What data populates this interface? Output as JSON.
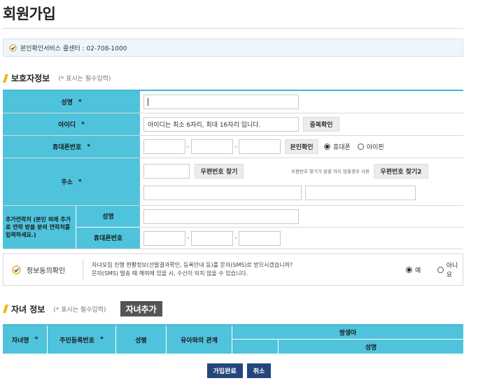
{
  "page": {
    "title": "회원가입"
  },
  "notice": {
    "text": "본인확인서비스 콜센터 : 02-708-1000",
    "icon": "check-circle-icon"
  },
  "guardian": {
    "title": "보호자정보",
    "note": "(* 표시는 필수입력)",
    "name_label": "성명",
    "id_label": "아이디",
    "id_hint": "아이디는 최소 6자리, 최대 16자리 입니다.",
    "dup_check_label": "중복확인",
    "phone_label": "휴대폰번호",
    "verify_label": "본인확인",
    "phone_type_options": [
      "휴대폰",
      "아이핀"
    ],
    "phone_type_selected": "휴대폰",
    "address_label": "주소",
    "zip_search_label": "우편번호 찾기",
    "zip_note": "우편번호 찾기가 원할 하지 않을경우 사용",
    "zip_search2_label": "우편번호 찾기2",
    "extra_contact_label": "추가연락처 (본인 외에 추가로 연락 받을 분의 연락처를 입력하세요.)",
    "extra_name_label": "성명",
    "extra_phone_label": "휴대폰번호",
    "required_mark": "*"
  },
  "consent": {
    "label": "정보동의확인",
    "line1": "자녀모집 진행 현황정보(선발결과확인, 등록안내 등)를 문자(SMS)로 받으시겠습니까?",
    "line2": "문자(SMS) 발송 때 해외에 있을 시, 수신이 되지 않을 수 있습니다.",
    "options": [
      "예",
      "아니요"
    ],
    "selected": "예"
  },
  "children": {
    "title": "자녀 정보",
    "note": "(* 표시는 필수입력)",
    "add_label": "자녀추가",
    "columns": [
      "자녀명",
      "주민등록번호",
      "성별",
      "유아와의 관계"
    ],
    "twin_label": "쌍생아",
    "twin_sub": "성명"
  },
  "actions": {
    "submit_label": "가입완료",
    "cancel_label": "취소"
  },
  "colors": {
    "header_cyan": "#4fc3dc",
    "accent_yellow": "#f0b400",
    "button_navy": "#24467a"
  }
}
